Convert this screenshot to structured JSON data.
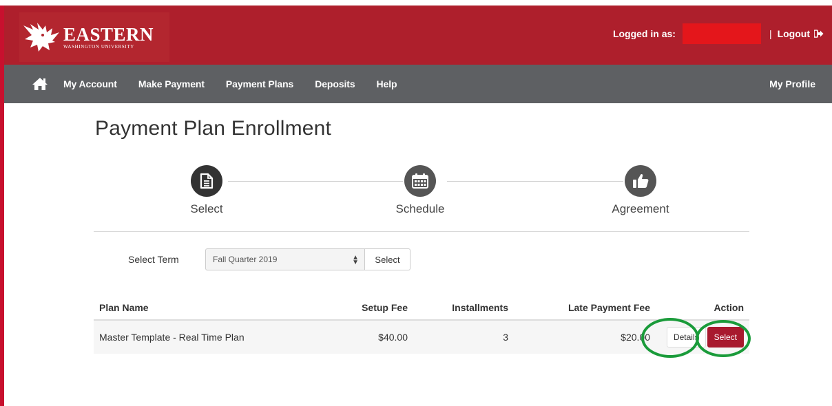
{
  "header": {
    "logo_main": "EASTERN",
    "logo_sub": "WASHINGTON UNIVERSITY",
    "logged_in_label": "Logged in as:",
    "separator": "|",
    "logout_label": "Logout",
    "brand_color": "#ae1f2c"
  },
  "nav": {
    "home_icon": "home-icon",
    "items": [
      {
        "label": "My Account"
      },
      {
        "label": "Make Payment"
      },
      {
        "label": "Payment Plans"
      },
      {
        "label": "Deposits"
      },
      {
        "label": "Help"
      }
    ],
    "right_label": "My Profile",
    "bg_color": "#5e6063"
  },
  "page": {
    "title": "Payment Plan Enrollment"
  },
  "stepper": {
    "steps": [
      {
        "label": "Select",
        "icon": "document-icon",
        "active": true
      },
      {
        "label": "Schedule",
        "icon": "calendar-icon",
        "active": false
      },
      {
        "label": "Agreement",
        "icon": "thumbs-up-icon",
        "active": false
      }
    ]
  },
  "term": {
    "label": "Select Term",
    "selected": "Fall Quarter 2019",
    "button_label": "Select"
  },
  "plans_table": {
    "headers": {
      "plan_name": "Plan Name",
      "setup_fee": "Setup Fee",
      "installments": "Installments",
      "late_fee": "Late Payment Fee",
      "action": "Action"
    },
    "rows": [
      {
        "plan_name": "Master Template - Real Time Plan",
        "setup_fee": "$40.00",
        "installments": "3",
        "late_fee": "$20.00",
        "details_label": "Details",
        "select_label": "Select"
      }
    ]
  },
  "annotation_color": "#1a9b3a"
}
